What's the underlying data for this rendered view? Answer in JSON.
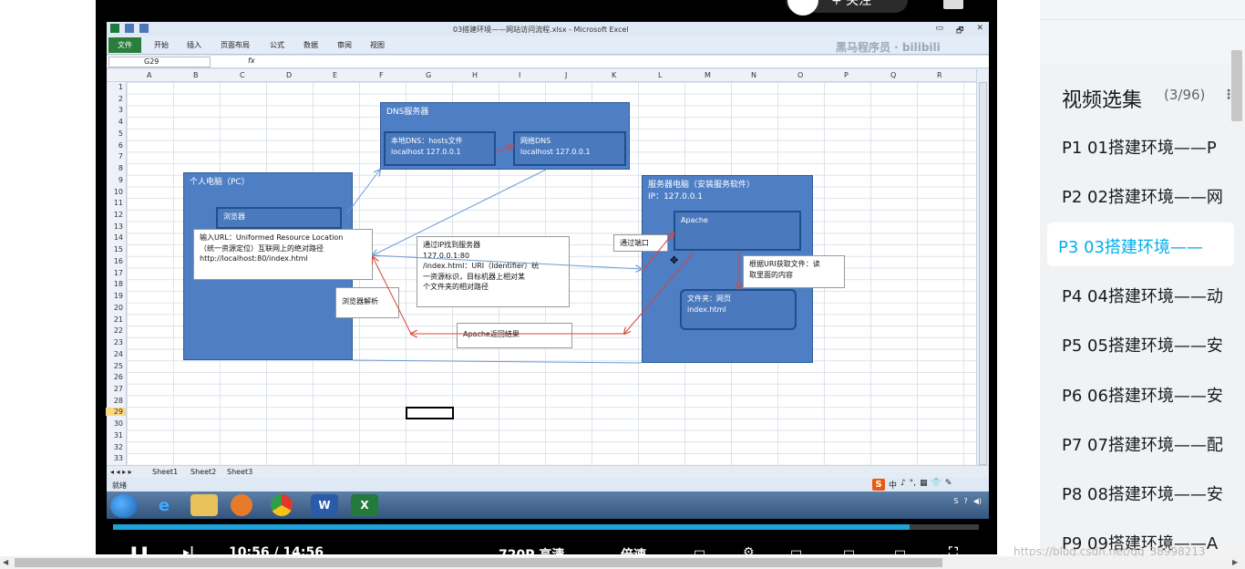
{
  "window": {
    "title": "03搭建环境——网站访问流程.xlsx - Microsoft Excel",
    "controls": [
      "▭",
      "🗗",
      "✕"
    ]
  },
  "ribbon": {
    "file_tab": "文件",
    "tabs": [
      "开始",
      "插入",
      "页面布局",
      "公式",
      "数据",
      "审阅",
      "视图"
    ],
    "watermark": "黑马程序员 · bilibili"
  },
  "formula_bar": {
    "name_box": "G29",
    "fx": "fx"
  },
  "columns": [
    "A",
    "B",
    "C",
    "D",
    "E",
    "F",
    "G",
    "H",
    "I",
    "J",
    "K",
    "L",
    "M",
    "N",
    "O",
    "P",
    "Q",
    "R"
  ],
  "rows": [
    "1",
    "2",
    "3",
    "4",
    "5",
    "6",
    "7",
    "8",
    "9",
    "10",
    "11",
    "12",
    "13",
    "14",
    "15",
    "16",
    "17",
    "18",
    "19",
    "20",
    "21",
    "22",
    "23",
    "24",
    "25",
    "26",
    "27",
    "28",
    "29",
    "30",
    "31",
    "32",
    "33"
  ],
  "diagram": {
    "dns_server": {
      "title": "DNS服务器",
      "local_dns": "本地DNS：hosts文件",
      "local_dns_value": "localhost   127.0.0.1",
      "net_dns": "网络DNS",
      "net_dns_value": "localhost    127.0.0.1"
    },
    "pc": {
      "title": "个人电脑（PC）",
      "browser": "浏览器",
      "url_line1": "输入URL：Uniformed Resource Location",
      "url_line2": "（统一资源定位）互联网上的绝对路径",
      "url_line3": "http://localhost:80/index.html"
    },
    "server": {
      "title": "服务器电脑（安装服务软件）",
      "ip": "IP：127.0.0.1",
      "apache": "Apache",
      "folder": "文件夹：网页",
      "file": "index.html"
    },
    "labels": {
      "find_server_title": "通过IP找到服务器",
      "find_server_l1": "127.0.0.1:80",
      "find_server_l2": "/index.html：URI（Identifier）统",
      "find_server_l3": "一资源标识，目标机器上相对某",
      "find_server_l4": "个文件夹的相对路径",
      "port": "通过端口",
      "uri_get_l1": "根据URI获取文件：读",
      "uri_get_l2": "取里面的内容",
      "browser_parse": "浏览器解析",
      "apache_return": "Apache返回结果"
    }
  },
  "sheets": [
    "Sheet1",
    "Sheet2",
    "Sheet3"
  ],
  "status": {
    "ready": "就绪",
    "ime": [
      "S",
      "中",
      "♪",
      "°,",
      "▦",
      "👕",
      "✎"
    ]
  },
  "taskbar": {
    "apps": [
      "ie",
      "folder",
      "media",
      "chrome",
      "word",
      "excel"
    ],
    "word_label": "W",
    "excel_label": "X",
    "ie_label": "e"
  },
  "player": {
    "follow_label": "+ 关注",
    "time": "10:56 / 14:56",
    "quality": "720P 高清",
    "speed": "倍速",
    "progress": 0.92
  },
  "playlist": {
    "title": "视频选集",
    "count": "(3/96)",
    "items": [
      "P1  01搭建环境——P",
      "P2  02搭建环境——网",
      "P3  03搭建环境——",
      "P4  04搭建环境——动",
      "P5  05搭建环境——安",
      "P6  06搭建环境——安",
      "P7  07搭建环境——配",
      "P8  08搭建环境——安",
      "P9  09搭建环境——A"
    ],
    "active_index": 2
  },
  "page_watermark": "https://blog.csdn.net/qq_38998213",
  "colors": {
    "box_fill": "#4e7ec4",
    "box_border": "#2e5b9a",
    "arrow_blue": "#6c9bd2",
    "arrow_red": "#d8453a",
    "active_episode": "#00aeec"
  }
}
